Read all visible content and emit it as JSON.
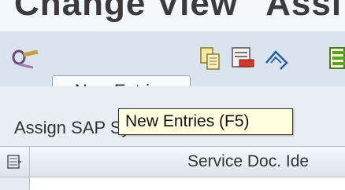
{
  "window": {
    "title": "Change View \"Assi"
  },
  "toolbar": {
    "new_entries_label": "New Entries",
    "icons": [
      "edit-pencil-icon",
      "copy-icon",
      "delete-icon",
      "undo-icon",
      "select-all-icon"
    ]
  },
  "section": {
    "title": "Assign SAP System Aliases to C"
  },
  "tooltip": {
    "text": "New Entries (F5)"
  },
  "table": {
    "columns": [
      "Service Doc. Ide"
    ]
  }
}
